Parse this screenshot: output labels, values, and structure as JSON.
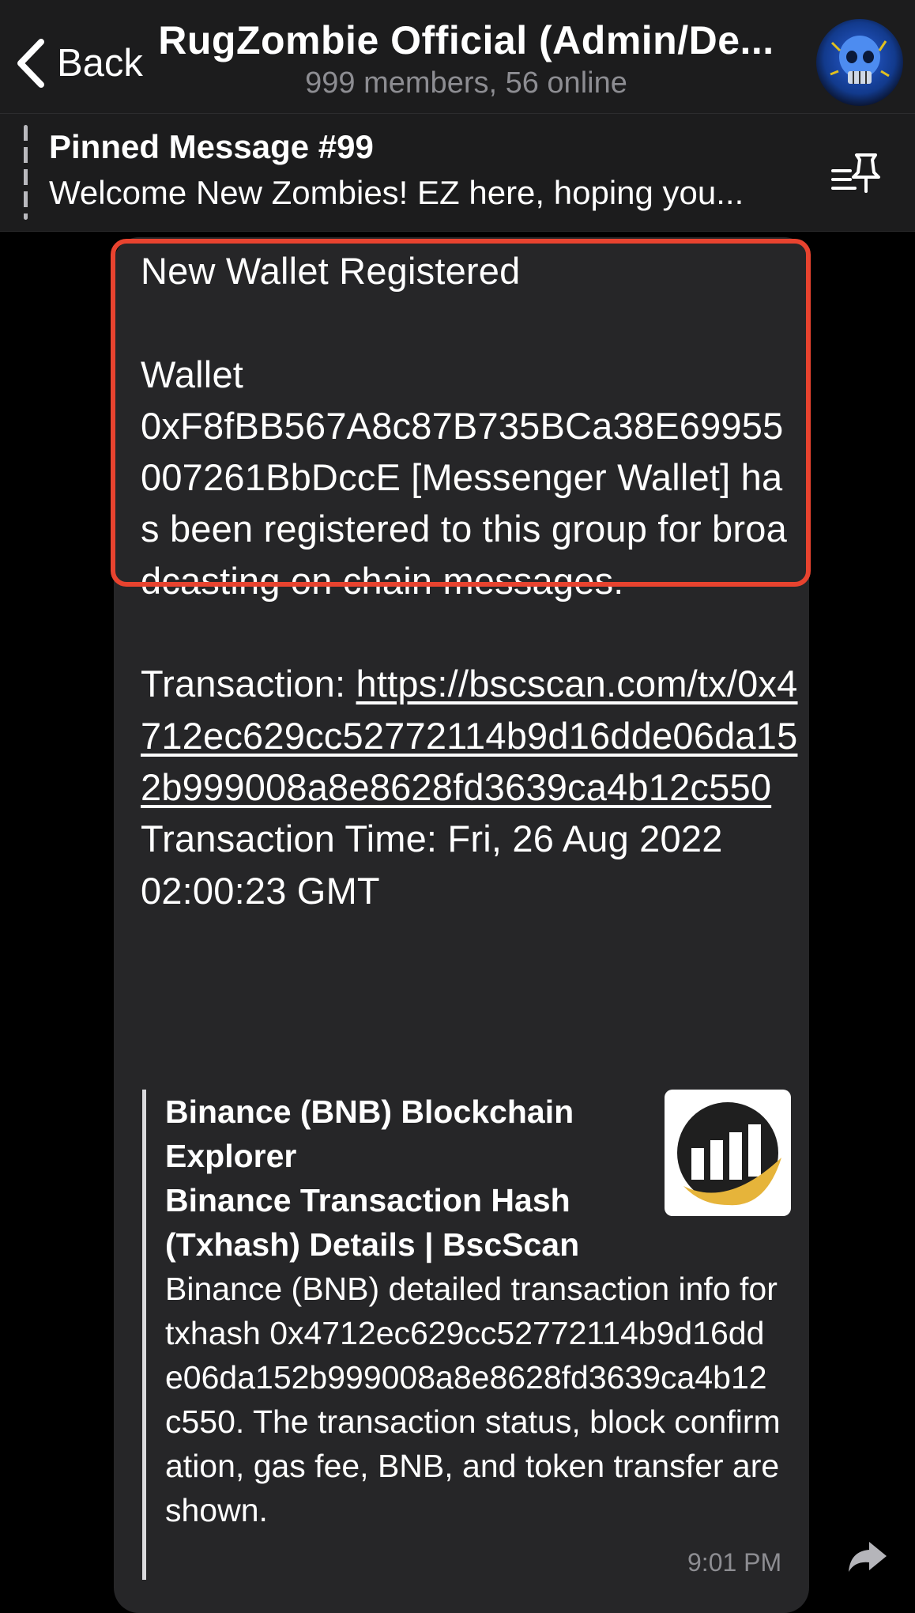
{
  "header": {
    "back_label": "Back",
    "title": "RugZombie Official (Admin/De...",
    "subtitle": "999 members, 56 online"
  },
  "pinned": {
    "title": "Pinned Message #99",
    "text": "Welcome New Zombies!     EZ here, hoping you..."
  },
  "message": {
    "heading": "New Wallet Registered",
    "wallet_label": "Wallet",
    "wallet_body": "0xF8fBB567A8c87B735BCa38E69955007261BbDccE [Messenger Wallet] has been registered to this group for broadcasting on chain messages.",
    "tx_label": "Transaction: ",
    "tx_link": "https://bscscan.com/tx/0x4712ec629cc52772114b9d16dde06da152b999008a8e8628fd3639ca4b12c550",
    "tx_time": "Transaction Time: Fri, 26 Aug 2022 02:00:23 GMT",
    "time": "9:01 PM"
  },
  "preview": {
    "site": "Binance (BNB) Blockchain Explorer",
    "title": "Binance Transaction Hash (Txhash) Details | BscScan",
    "description": "Binance (BNB) detailed transaction info for txhash 0x4712ec629cc52772114b9d16dde06da152b999008a8e8628fd3639ca4b12c550. The transaction status, block confirmation, gas fee, BNB, and token transfer are shown."
  },
  "icons": {
    "back": "chevron-left-icon",
    "pin_list": "pin-list-icon",
    "share": "share-arrow-icon",
    "thumb": "bscscan-logo"
  },
  "colors": {
    "highlight": "#e8432f",
    "bubble": "#262628",
    "header": "#1c1c1d"
  }
}
